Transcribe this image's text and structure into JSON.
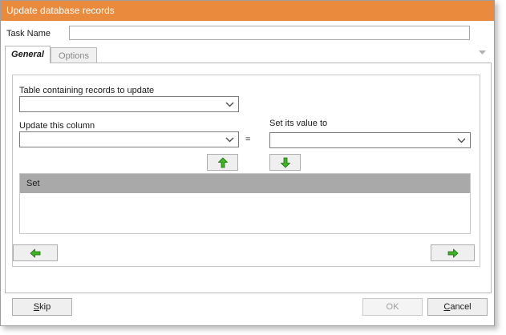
{
  "window": {
    "title": "Update database records"
  },
  "task_name": {
    "label": "Task Name",
    "value": ""
  },
  "tabs": [
    {
      "label": "General",
      "active": true
    },
    {
      "label": "Options",
      "active": false
    }
  ],
  "general": {
    "table_label": "Table containing records to update",
    "table_value": "",
    "column_label": "Update this column",
    "column_value": "",
    "equals": "=",
    "value_label": "Set its value to",
    "value_value": "",
    "list_header": "Set"
  },
  "footer": {
    "skip_prefix": "S",
    "skip_rest": "kip",
    "ok_label": "OK",
    "cancel_prefix": "C",
    "cancel_rest": "ancel"
  },
  "icons": {
    "move_up": "arrow-up-icon",
    "move_down": "arrow-down-icon",
    "back": "arrow-left-icon",
    "next": "arrow-right-icon"
  },
  "colors": {
    "titlebar": "#ea8a3c",
    "arrow_green": "#3cb521",
    "list_header": "#a9a9a9"
  }
}
